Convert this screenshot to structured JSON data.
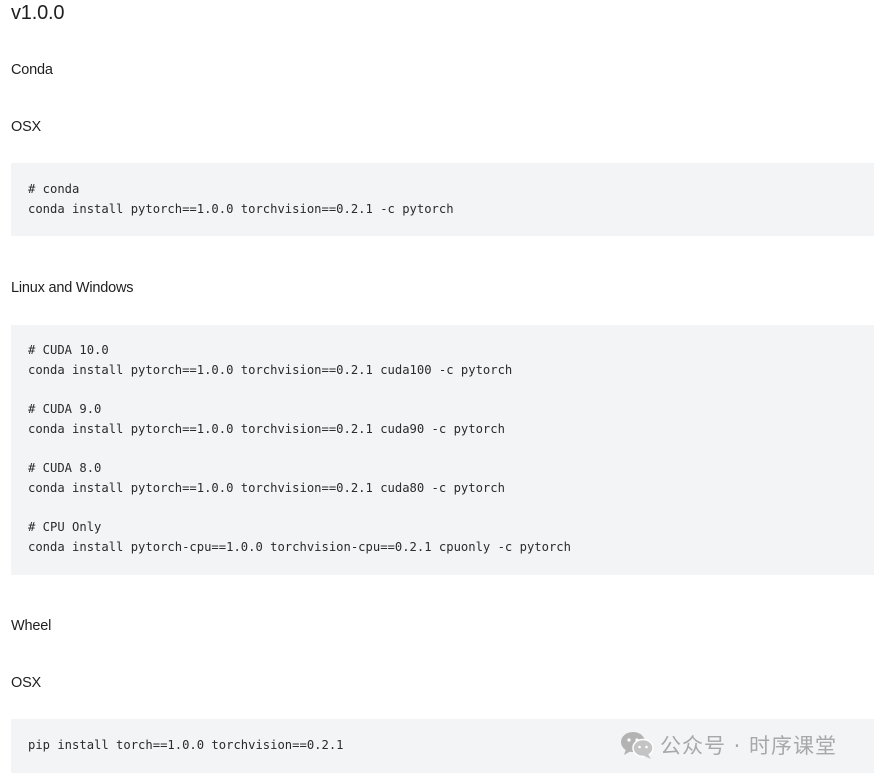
{
  "version_heading": "v1.0.0",
  "conda_heading": "Conda",
  "conda_osx": {
    "label": "OSX",
    "lines": [
      "# conda",
      "conda install pytorch==1.0.0 torchvision==0.2.1 -c pytorch"
    ]
  },
  "conda_linux_windows": {
    "label": "Linux and Windows",
    "groups": [
      [
        "# CUDA 10.0",
        "conda install pytorch==1.0.0 torchvision==0.2.1 cuda100 -c pytorch"
      ],
      [
        "# CUDA 9.0",
        "conda install pytorch==1.0.0 torchvision==0.2.1 cuda90 -c pytorch"
      ],
      [
        "# CUDA 8.0",
        "conda install pytorch==1.0.0 torchvision==0.2.1 cuda80 -c pytorch"
      ],
      [
        "# CPU Only",
        "conda install pytorch-cpu==1.0.0 torchvision-cpu==0.2.1 cpuonly -c pytorch"
      ]
    ]
  },
  "wheel_heading": "Wheel",
  "wheel_osx": {
    "label": "OSX",
    "lines": [
      "pip install torch==1.0.0 torchvision==0.2.1"
    ]
  },
  "watermark": {
    "icon": "wechat-icon",
    "text": "公众号 · 时序课堂"
  }
}
